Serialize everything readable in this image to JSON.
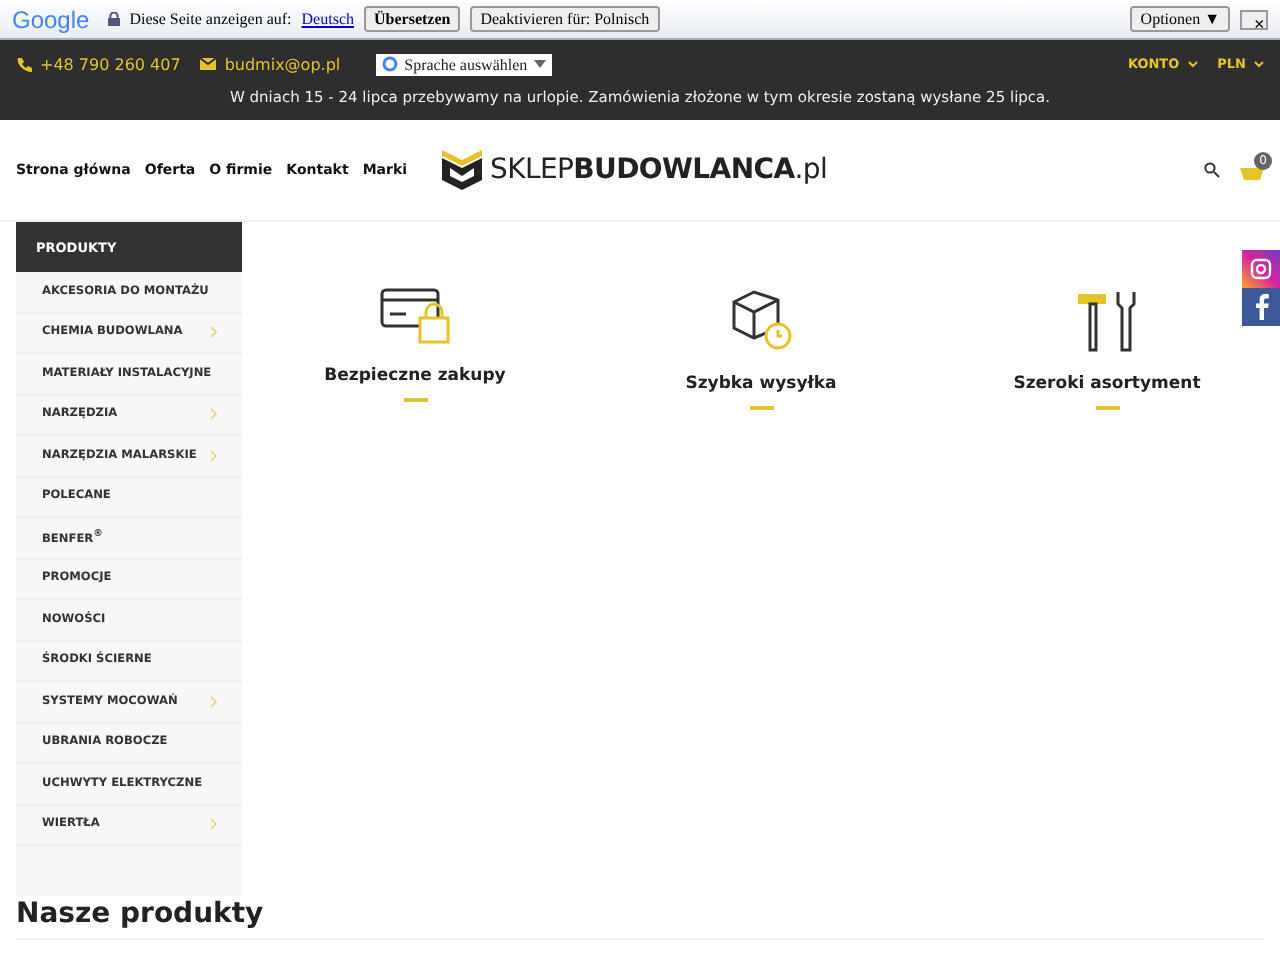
{
  "translate_bar": {
    "logo": "Google",
    "prompt": "Diese Seite anzeigen auf:",
    "language": "Deutsch",
    "translate_button": "Übersetzen",
    "disable_button": "Deaktivieren für: Polnisch",
    "options_button": "Optionen ▼",
    "close": "×"
  },
  "top_bar": {
    "phone": "+48 790 260 407",
    "email": "budmix@op.pl",
    "language_select": "Sprache auswählen",
    "account": "KONTO",
    "currency": "PLN",
    "notice": "W dniach 15 - 24 lipca przebywamy na urlopie. Zamówienia złożone w tym okresie zostaną wysłane 25 lipca."
  },
  "header": {
    "nav": [
      "Strona główna",
      "Oferta",
      "O firmie",
      "Kontakt",
      "Marki"
    ],
    "logo": "SKLEP**BUDOWLANCA**.pl",
    "cart_count": "0"
  },
  "sidebar": {
    "title": "PRODUKTY",
    "items": [
      {
        "label": "AKCESORIA DO MONTAŻU",
        "has_submenu": false
      },
      {
        "label": "CHEMIA BUDOWLANA",
        "has_submenu": true
      },
      {
        "label": "MATERIAŁY INSTALACYJNE",
        "has_submenu": false
      },
      {
        "label": "NARZĘDZIA",
        "has_submenu": true
      },
      {
        "label": "NARZĘDZIA MALARSKIE",
        "has_submenu": true
      },
      {
        "label": "POLECANE",
        "has_submenu": false
      },
      {
        "label": "BENFER$^{®}$",
        "has_submenu": false
      },
      {
        "label": "PROMOCJE",
        "has_submenu": false
      },
      {
        "label": "NOWOŚCI",
        "has_submenu": false
      },
      {
        "label": "ŚRODKI ŚCIERNE",
        "has_submenu": false
      },
      {
        "label": "SYSTEMY MOCOWAŃ",
        "has_submenu": true
      },
      {
        "label": "UBRANIA ROBOCZE",
        "has_submenu": false
      },
      {
        "label": "UCHWYTY ELEKTRYCZNE",
        "has_submenu": false
      },
      {
        "label": "WIERTŁA",
        "has_submenu": true
      }
    ]
  },
  "features": [
    {
      "kind": "secure",
      "label": "Bezpieczne zakupy"
    },
    {
      "kind": "shipping",
      "label": "Szybka wysyłka"
    },
    {
      "kind": "tools",
      "label": "Szeroki asortyment"
    }
  ],
  "section_title": "Nasze produkty"
}
